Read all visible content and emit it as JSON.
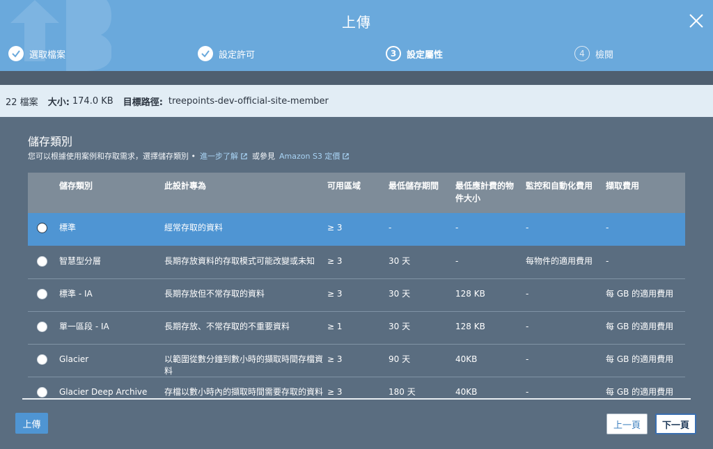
{
  "header": {
    "title": "上傳",
    "steps": [
      {
        "label": "選取檔案",
        "state": "done"
      },
      {
        "label": "設定許可",
        "state": "done"
      },
      {
        "label": "設定屬性",
        "state": "active",
        "number": "3"
      },
      {
        "label": "檢閱",
        "state": "todo",
        "number": "4"
      }
    ]
  },
  "summary": {
    "files": "22 檔案",
    "size_label": "大小:",
    "size_value": "174.0 KB",
    "target_label": "目標路徑:",
    "target_value": "treepoints-dev-official-site-member"
  },
  "section": {
    "title": "儲存類別",
    "desc": "您可以根據使用案例和存取需求，選擇儲存類別 •",
    "learn_more": "進一步了解",
    "or_see": "或參見",
    "pricing_link": "Amazon S3 定價"
  },
  "table": {
    "headers": [
      "儲存類別",
      "此設計專為",
      "可用區域",
      "最低儲存期間",
      "最低應計費的物件大小",
      "監控和自動化費用",
      "擷取費用"
    ],
    "rows": [
      {
        "cls": "標準",
        "designed": "經常存取的資料",
        "az": "≥ 3",
        "min_dur": "-",
        "min_size": "-",
        "monitor": "-",
        "retrieval": "-"
      },
      {
        "cls": "智慧型分層",
        "designed": "長期存放資料的存取模式可能改變或未知",
        "az": "≥ 3",
        "min_dur": "30 天",
        "min_size": "-",
        "monitor": "每物件的適用費用",
        "retrieval": "-"
      },
      {
        "cls": "標準 - IA",
        "designed": "長期存放但不常存取的資料",
        "az": "≥ 3",
        "min_dur": "30 天",
        "min_size": "128 KB",
        "monitor": "-",
        "retrieval": "每 GB 的適用費用"
      },
      {
        "cls": "單一區段 - IA",
        "designed": "長期存放、不常存取的不重要資料",
        "az": "≥ 1",
        "min_dur": "30 天",
        "min_size": "128 KB",
        "monitor": "-",
        "retrieval": "每 GB 的適用費用"
      },
      {
        "cls": "Glacier",
        "designed": "以範圍從數分鐘到數小時的擷取時間存檔資料",
        "az": "≥ 3",
        "min_dur": "90 天",
        "min_size": "40KB",
        "monitor": "-",
        "retrieval": "每 GB 的適用費用"
      },
      {
        "cls": "Glacier Deep Archive",
        "designed": "存檔以數小時內的擷取時間需要存取的資料 (保也",
        "az": "≥ 3",
        "min_dur": "180 天",
        "min_size": "40KB",
        "monitor": "-",
        "retrieval": "每 GB 的適用費用"
      }
    ]
  },
  "footer": {
    "upload": "上傳",
    "prev": "上一頁",
    "next": "下一頁"
  },
  "colors": {
    "header": "#6aa9dc",
    "body": "#5a6d80",
    "selected_row": "#4f95d3",
    "link": "#a9d4f5"
  }
}
